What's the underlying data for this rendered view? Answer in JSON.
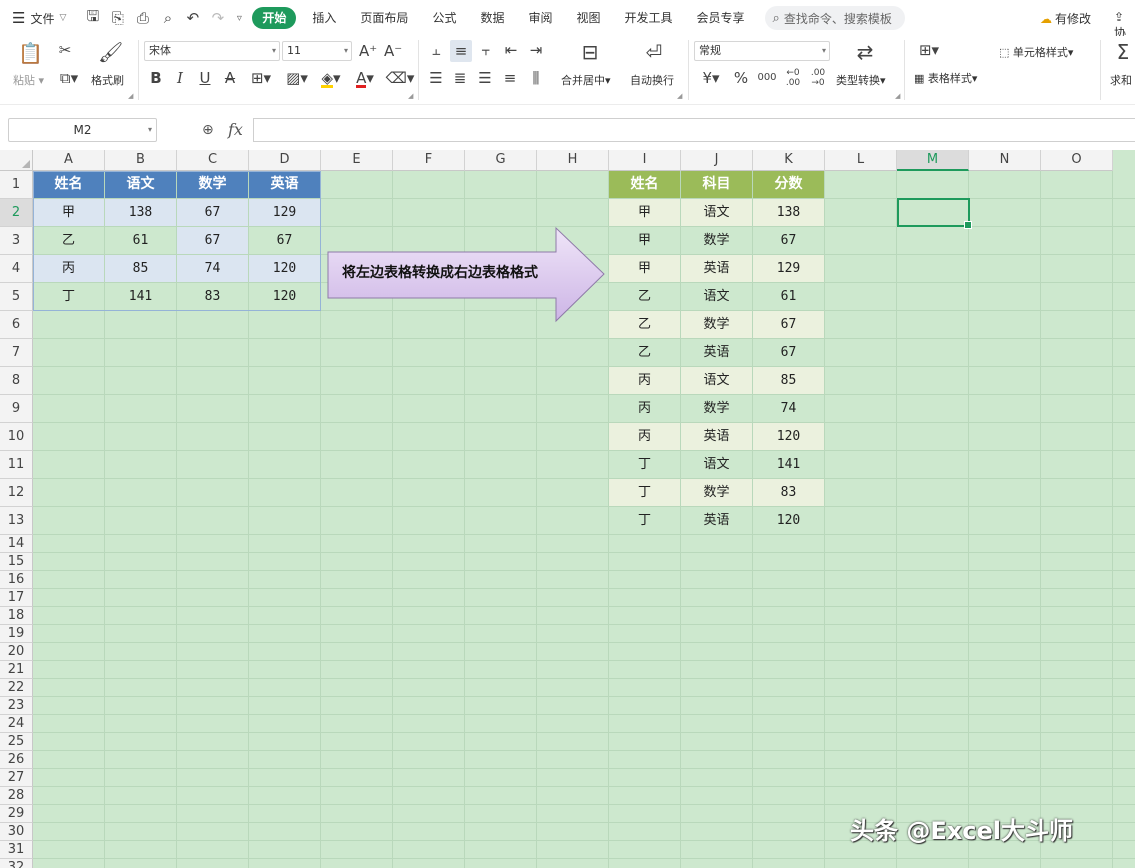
{
  "menubar": {
    "file_label": "文件",
    "tabs": [
      "开始",
      "插入",
      "页面布局",
      "公式",
      "数据",
      "审阅",
      "视图",
      "开发工具",
      "会员专享"
    ],
    "search_placeholder": "查找命令、搜索模板",
    "modified_label": "有修改",
    "collab_label": "协"
  },
  "ribbon": {
    "paste_label": "粘贴",
    "format_painter_label": "格式刷",
    "font_name": "宋体",
    "font_size": "11",
    "merge_center_label": "合并居中",
    "wrap_text_label": "自动换行",
    "number_format": "常规",
    "type_convert_label": "类型转换",
    "cell_style_label": "单元格样式",
    "table_style_label": "表格样式",
    "sum_label": "求和"
  },
  "formula_bar": {
    "name_box": "M2",
    "fx_label": "fx",
    "content": ""
  },
  "sheet": {
    "columns": [
      "A",
      "B",
      "C",
      "D",
      "E",
      "F",
      "G",
      "H",
      "I",
      "J",
      "K",
      "L",
      "M",
      "N",
      "O"
    ],
    "rows": [
      "1",
      "2",
      "3",
      "4",
      "5",
      "6",
      "7",
      "8",
      "9",
      "10",
      "11",
      "12",
      "13",
      "14",
      "15",
      "16",
      "17",
      "18",
      "19",
      "20",
      "21",
      "22",
      "23",
      "24",
      "25",
      "26",
      "27",
      "28",
      "29",
      "30",
      "31",
      "32"
    ],
    "selected_column": "M",
    "selected_row": "2",
    "active_cell": "M2"
  },
  "left_table": {
    "headers": [
      "姓名",
      "语文",
      "数学",
      "英语"
    ],
    "rows": [
      [
        "甲",
        "138",
        "67",
        "129"
      ],
      [
        "乙",
        "61",
        "67",
        "67"
      ],
      [
        "丙",
        "85",
        "74",
        "120"
      ],
      [
        "丁",
        "141",
        "83",
        "120"
      ]
    ]
  },
  "right_table": {
    "headers": [
      "姓名",
      "科目",
      "分数"
    ],
    "rows": [
      [
        "甲",
        "语文",
        "138"
      ],
      [
        "甲",
        "数学",
        "67"
      ],
      [
        "甲",
        "英语",
        "129"
      ],
      [
        "乙",
        "语文",
        "61"
      ],
      [
        "乙",
        "数学",
        "67"
      ],
      [
        "乙",
        "英语",
        "67"
      ],
      [
        "丙",
        "语文",
        "85"
      ],
      [
        "丙",
        "数学",
        "74"
      ],
      [
        "丙",
        "英语",
        "120"
      ],
      [
        "丁",
        "语文",
        "141"
      ],
      [
        "丁",
        "数学",
        "83"
      ],
      [
        "丁",
        "英语",
        "120"
      ]
    ]
  },
  "callout": {
    "text": "将左边表格转换成右边表格格式"
  },
  "watermark": {
    "text": "头条 @Excel大斗师"
  },
  "colors": {
    "accent": "#1e9a5c",
    "sheet_bg": "#cde8ce",
    "left_header": "#4f81bd",
    "left_band": "#dbe5f1",
    "right_header": "#9bbb59",
    "right_band": "#ebf1de",
    "arrow_fill": "#dcc9ee"
  }
}
